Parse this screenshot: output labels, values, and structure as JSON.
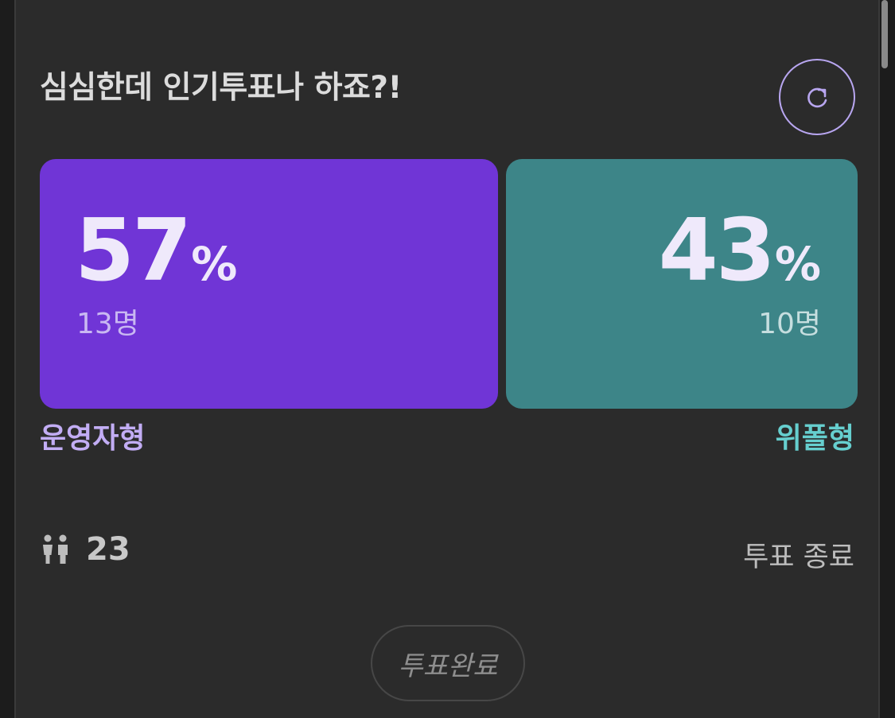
{
  "poll": {
    "title": "심심한데 인기투표나 하죠?!",
    "options": [
      {
        "label": "운영자형",
        "percent": "57",
        "percent_sign": "%",
        "count": "13명",
        "color": "#7035d6",
        "label_color": "#c2adf4",
        "share": 0.57
      },
      {
        "label": "위폴형",
        "percent": "43",
        "percent_sign": "%",
        "count": "10명",
        "color": "#3d8588",
        "label_color": "#66cfcf",
        "share": 0.43
      }
    ],
    "voter_icon": "people-icon",
    "total_voters": "23",
    "status": "투표 종료",
    "done_button_label": "투표완료",
    "refresh_icon": "refresh-icon"
  }
}
